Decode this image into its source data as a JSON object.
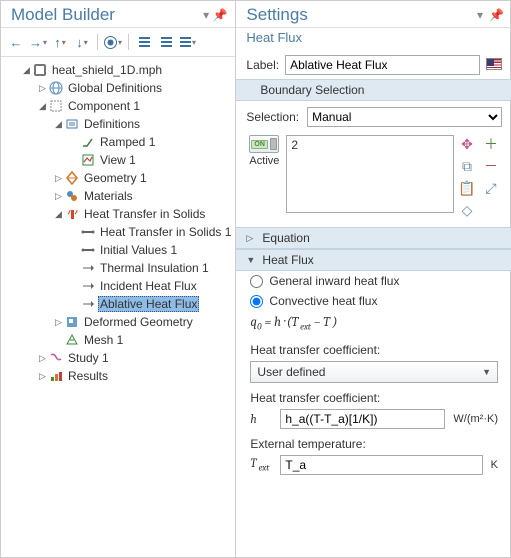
{
  "left": {
    "title": "Model Builder",
    "tree": {
      "root": "heat_shield_1D.mph",
      "global_defs": "Global Definitions",
      "component": "Component 1",
      "definitions": "Definitions",
      "ramped": "Ramped 1",
      "view": "View 1",
      "geometry": "Geometry 1",
      "materials": "Materials",
      "ht": "Heat Transfer in Solids",
      "ht_solids": "Heat Transfer in Solids 1",
      "initial": "Initial Values 1",
      "thermal": "Thermal Insulation 1",
      "incident": "Incident Heat Flux",
      "ablative": "Ablative Heat Flux",
      "deformed": "Deformed Geometry",
      "mesh": "Mesh 1",
      "study": "Study 1",
      "results": "Results"
    }
  },
  "right": {
    "title": "Settings",
    "subtitle": "Heat Flux",
    "label_lbl": "Label:",
    "label_val": "Ablative Heat Flux",
    "section_boundary": "Boundary Selection",
    "selection_lbl": "Selection:",
    "selection_val": "Manual",
    "active_lbl": "Active",
    "selection_items": [
      "2"
    ],
    "section_equation": "Equation",
    "section_heatflux": "Heat Flux",
    "radio_general": "General inward heat flux",
    "radio_convective": "Convective heat flux",
    "htc_lbl": "Heat transfer coefficient:",
    "htc_select": "User defined",
    "htc2_lbl": "Heat transfer coefficient:",
    "h_sym": "h",
    "h_val": "h_a((T-T_a)[1/K])",
    "h_unit": "W/(m²·K)",
    "ext_temp_lbl": "External temperature:",
    "Text_val": "T_a",
    "Text_unit": "K"
  }
}
